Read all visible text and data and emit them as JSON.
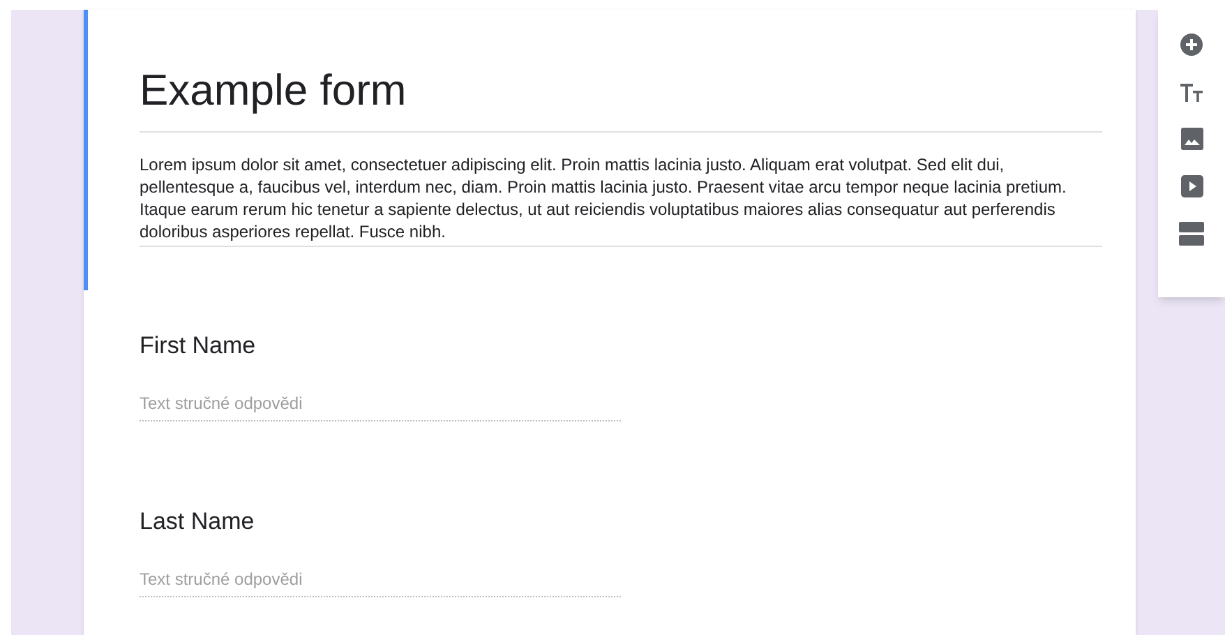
{
  "form": {
    "title": "Example form",
    "description": "Lorem ipsum dolor sit amet, consectetuer adipiscing elit. Proin mattis lacinia justo. Aliquam erat volutpat. Sed elit dui, pellentesque a, faucibus vel, interdum nec, diam. Proin mattis lacinia justo. Praesent vitae arcu tempor neque lacinia pretium. Itaque earum rerum hic tenetur a sapiente delectus, ut aut reiciendis voluptatibus maiores alias consequatur aut perferendis doloribus asperiores repellat. Fusce nibh."
  },
  "questions": [
    {
      "label": "First Name",
      "placeholder": "Text stručné odpovědi"
    },
    {
      "label": "Last Name",
      "placeholder": "Text stručné odpovědi"
    }
  ]
}
